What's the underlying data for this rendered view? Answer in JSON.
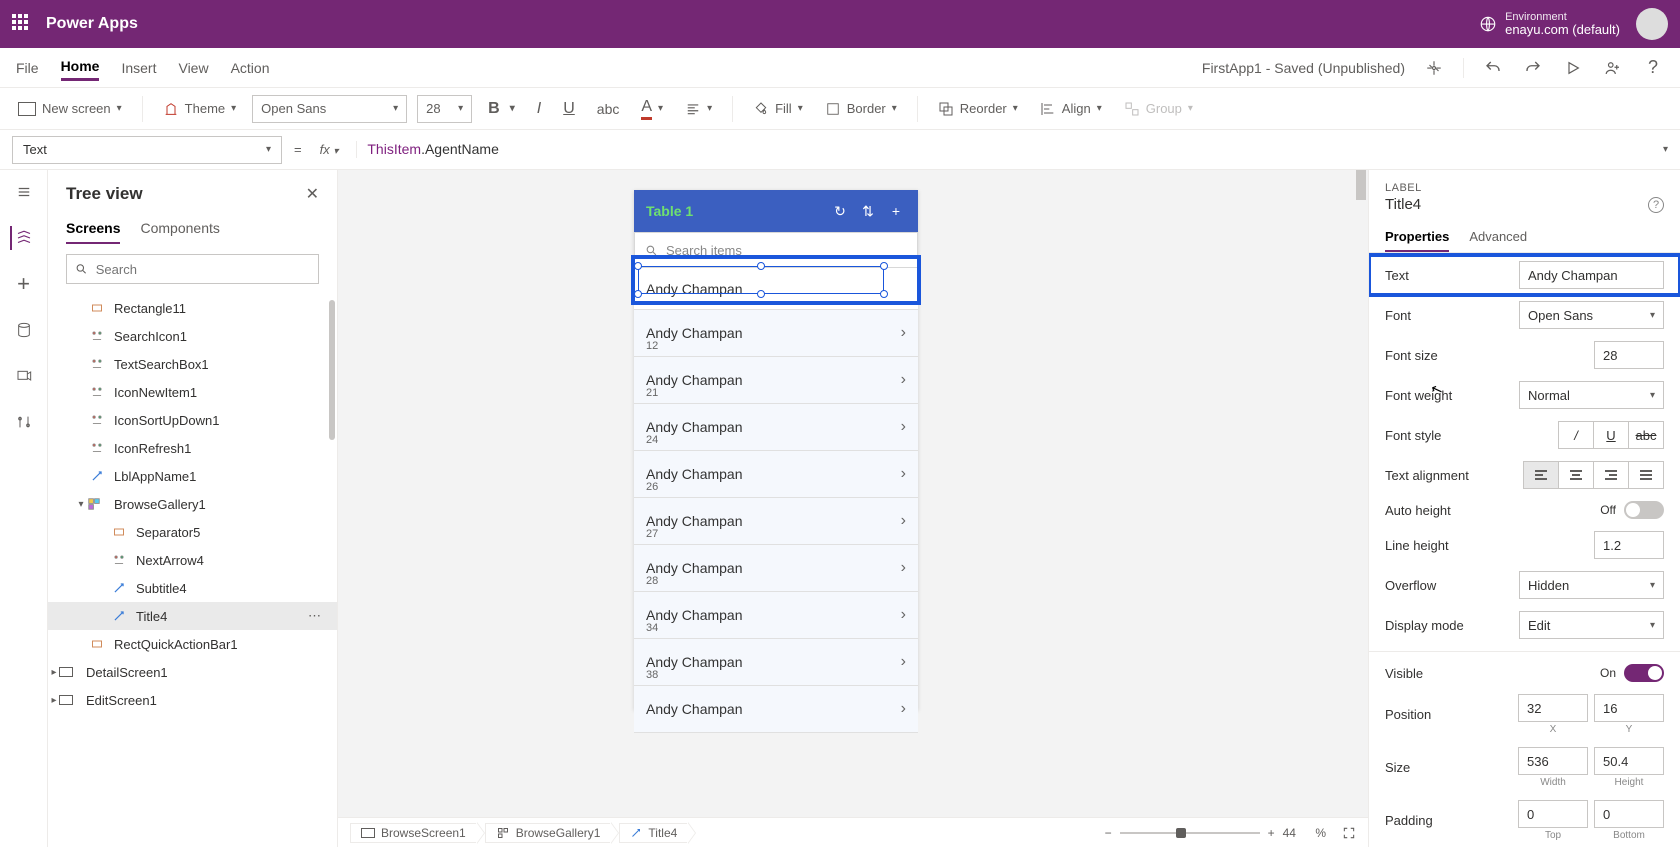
{
  "brand": "Power Apps",
  "environment": {
    "label": "Environment",
    "value": "enayu.com (default)"
  },
  "menubar": {
    "file": "File",
    "home": "Home",
    "insert": "Insert",
    "view": "View",
    "action": "Action",
    "status": "FirstApp1 - Saved (Unpublished)"
  },
  "toolbar": {
    "newScreen": "New screen",
    "theme": "Theme",
    "font": "Open Sans",
    "fontSize": "28",
    "fill": "Fill",
    "border": "Border",
    "reorder": "Reorder",
    "align": "Align",
    "group": "Group"
  },
  "formulabar": {
    "property": "Text",
    "fx": "fx",
    "formulaObj": "ThisItem",
    "formulaProp": ".AgentName"
  },
  "tree": {
    "title": "Tree view",
    "tabs": {
      "screens": "Screens",
      "components": "Components"
    },
    "searchPlaceholder": "Search",
    "items": [
      {
        "name": "Rectangle11",
        "indent": 1
      },
      {
        "name": "SearchIcon1",
        "indent": 1
      },
      {
        "name": "TextSearchBox1",
        "indent": 1
      },
      {
        "name": "IconNewItem1",
        "indent": 1
      },
      {
        "name": "IconSortUpDown1",
        "indent": 1
      },
      {
        "name": "IconRefresh1",
        "indent": 1
      },
      {
        "name": "LblAppName1",
        "indent": 1
      },
      {
        "name": "BrowseGallery1",
        "indent": 1,
        "expand": true
      },
      {
        "name": "Separator5",
        "indent": 2
      },
      {
        "name": "NextArrow4",
        "indent": 2
      },
      {
        "name": "Subtitle4",
        "indent": 2
      },
      {
        "name": "Title4",
        "indent": 2,
        "selected": true
      },
      {
        "name": "RectQuickActionBar1",
        "indent": 1
      },
      {
        "name": "DetailScreen1",
        "indent": 0,
        "expand": false
      },
      {
        "name": "EditScreen1",
        "indent": 0,
        "expand": false
      }
    ]
  },
  "canvas": {
    "headerTitle": "Table 1",
    "searchPlaceholder": "Search items",
    "rows": [
      {
        "name": "Andy Champan",
        "sub": ""
      },
      {
        "name": "Andy Champan",
        "sub": "12"
      },
      {
        "name": "Andy Champan",
        "sub": "21"
      },
      {
        "name": "Andy Champan",
        "sub": "24"
      },
      {
        "name": "Andy Champan",
        "sub": "26"
      },
      {
        "name": "Andy Champan",
        "sub": "27"
      },
      {
        "name": "Andy Champan",
        "sub": "28"
      },
      {
        "name": "Andy Champan",
        "sub": "34"
      },
      {
        "name": "Andy Champan",
        "sub": "38"
      },
      {
        "name": "Andy Champan",
        "sub": ""
      }
    ],
    "breadcrumb": [
      "BrowseScreen1",
      "BrowseGallery1",
      "Title4"
    ],
    "zoomValue": "44",
    "zoomPct": "%"
  },
  "props": {
    "typeLabel": "LABEL",
    "name": "Title4",
    "tabs": {
      "properties": "Properties",
      "advanced": "Advanced"
    },
    "rows": {
      "text": {
        "label": "Text",
        "value": "Andy Champan"
      },
      "font": {
        "label": "Font",
        "value": "Open Sans"
      },
      "fontSize": {
        "label": "Font size",
        "value": "28"
      },
      "fontWeight": {
        "label": "Font weight",
        "value": "Normal"
      },
      "fontStyle": {
        "label": "Font style"
      },
      "textAlign": {
        "label": "Text alignment"
      },
      "autoHeight": {
        "label": "Auto height",
        "state": "Off"
      },
      "lineHeight": {
        "label": "Line height",
        "value": "1.2"
      },
      "overflow": {
        "label": "Overflow",
        "value": "Hidden"
      },
      "displayMode": {
        "label": "Display mode",
        "value": "Edit"
      },
      "visible": {
        "label": "Visible",
        "state": "On"
      },
      "position": {
        "label": "Position",
        "x": "32",
        "y": "16",
        "xLabel": "X",
        "yLabel": "Y"
      },
      "size": {
        "label": "Size",
        "w": "536",
        "h": "50.4",
        "wLabel": "Width",
        "hLabel": "Height"
      },
      "padding": {
        "label": "Padding",
        "top": "0",
        "bottom": "0",
        "topLabel": "Top",
        "bottomLabel": "Bottom"
      }
    }
  }
}
